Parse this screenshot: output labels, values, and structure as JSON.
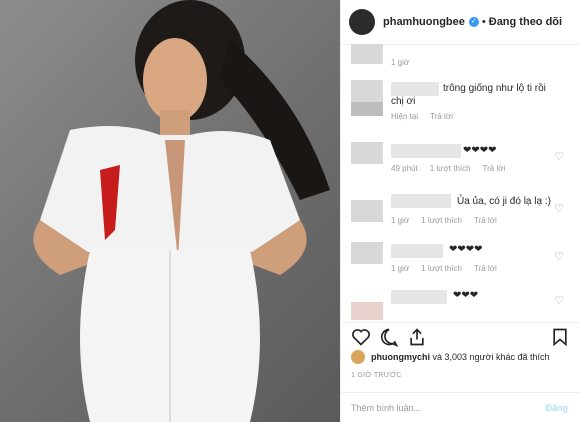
{
  "header": {
    "username": "phamhuongbee",
    "separator": "•",
    "follow_label": "Đang theo dõi",
    "verified_mark": "✓"
  },
  "comments": [
    {
      "text": "",
      "meta": [
        "1 giờ"
      ],
      "heart": ""
    },
    {
      "text": "trông giống như lộ ti rồi",
      "text2": "chị ơi",
      "meta": [
        "Hiện tại",
        "Trả lời"
      ],
      "heart": ""
    },
    {
      "text": "❤❤❤❤",
      "meta": [
        "49 phút",
        "1 lượt thích",
        "Trả lời"
      ],
      "heart": "♡"
    },
    {
      "text": "Ủa ủa, có ji đó lạ lạ :)",
      "meta": [
        "1 giờ",
        "1 lượt thích",
        "Trả lời"
      ],
      "heart": "♡"
    },
    {
      "text": "❤❤❤❤",
      "meta": [
        "1 giờ",
        "1 lượt thích",
        "Trả lời"
      ],
      "heart": "♡"
    },
    {
      "text": "❤❤❤",
      "meta": [],
      "heart": "♡"
    }
  ],
  "actions": {
    "like_icon": "heart-outline-icon",
    "comment_icon": "comment-bubble-icon",
    "share_icon": "share-arrow-icon",
    "save_icon": "bookmark-icon"
  },
  "likes": {
    "liker": "phuongmychi",
    "rest": " và 3,003 người khác đã thích"
  },
  "time_label": "1 GIỜ TRƯỚC",
  "add_comment": {
    "placeholder": "Thêm bình luận...",
    "post_label": "Đăng"
  }
}
